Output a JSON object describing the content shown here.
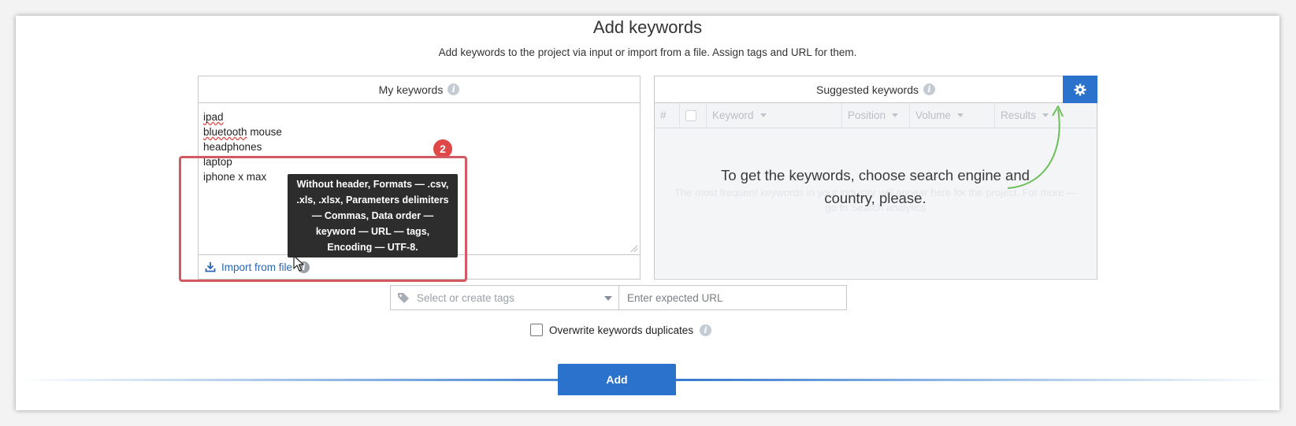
{
  "header": {
    "title": "Add keywords",
    "subtitle": "Add keywords to the project via input or import from a file. Assign tags and URL for them."
  },
  "my_keywords": {
    "title": "My keywords",
    "keywords": [
      "ipad",
      "bluetooth mouse",
      "headphones",
      "laptop",
      "iphone x max"
    ],
    "import_label": "Import from file",
    "badge": "2"
  },
  "tooltip": {
    "text": "Without header, Formats — .csv, .xls, .xlsx, Parameters delimiters — Commas, Data order — keyword — URL — tags, Encoding — UTF-8."
  },
  "suggested": {
    "title": "Suggested keywords",
    "columns": [
      "#",
      "",
      "Keyword",
      "Position",
      "Volume",
      "Results"
    ],
    "empty_text": "The most frequent keywords in your industry will appear here for the project. For more — go to Search analytics",
    "overlay_message": "To get the keywords, choose search engine and country, please."
  },
  "form": {
    "tags_placeholder": "Select or create tags",
    "url_placeholder": "Enter expected URL",
    "overwrite_label": "Overwrite keywords duplicates",
    "overwrite_checked": false,
    "add_label": "Add"
  },
  "colors": {
    "accent": "#2b72cc",
    "highlight": "#d05a5f",
    "badge": "#e04848",
    "arrow": "#6cbf5a"
  }
}
